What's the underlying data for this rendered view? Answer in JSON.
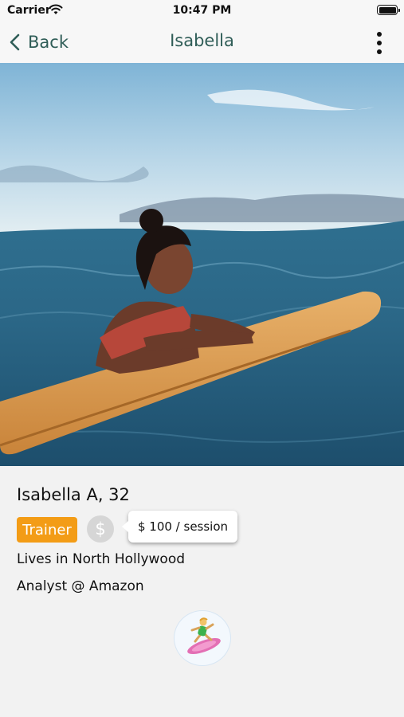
{
  "status_bar": {
    "carrier": "Carrier",
    "time": "10:47 PM",
    "icons": [
      "wifi-icon",
      "battery-icon"
    ]
  },
  "nav": {
    "back_label": "Back",
    "title": "Isabella",
    "icons": [
      "chevron-left-icon",
      "more-vertical-icon"
    ]
  },
  "photo": {
    "subject": "woman in swimsuit leaning on a surfboard in the ocean"
  },
  "profile": {
    "name_age": "Isabella A, 32",
    "role_badge": "Trainer",
    "price_symbol": "$",
    "price_text": "$ 100 / session",
    "location": "Lives in North Hollywood",
    "job": "Analyst @ Amazon",
    "activity_icon": "surfer-icon"
  },
  "colors": {
    "accent_teal": "#2f5d57",
    "badge_orange": "#f39c16",
    "background": "#f2f2f2",
    "price_icon_gray": "#d6d6d6"
  }
}
